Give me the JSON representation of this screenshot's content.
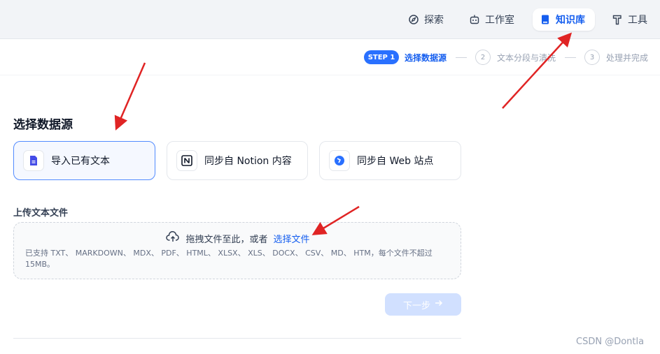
{
  "nav": {
    "items": [
      {
        "label": "探索",
        "icon": "compass-icon",
        "active": false
      },
      {
        "label": "工作室",
        "icon": "robot-icon",
        "active": false
      },
      {
        "label": "知识库",
        "icon": "book-icon",
        "active": true
      },
      {
        "label": "工具",
        "icon": "hammer-icon",
        "active": false
      }
    ]
  },
  "steps": {
    "badge": "STEP 1",
    "step1_label": "选择数据源",
    "step2_num": "2",
    "step2_label": "文本分段与清洗",
    "step3_num": "3",
    "step3_label": "处理并完成"
  },
  "main": {
    "title": "选择数据源",
    "sources": [
      {
        "label": "导入已有文本",
        "icon": "file-text-icon",
        "selected": true
      },
      {
        "label": "同步自 Notion 内容",
        "icon": "notion-icon",
        "selected": false
      },
      {
        "label": "同步自 Web 站点",
        "icon": "web-sync-icon",
        "selected": false
      }
    ],
    "upload_title": "上传文本文件",
    "dropzone": {
      "text": "拖拽文件至此，或者",
      "link": "选择文件",
      "hint": "已支持 TXT、 MARKDOWN、 MDX、 PDF、 HTML、 XLSX、 XLS、 DOCX、 CSV、 MD、 HTM，每个文件不超过 15MB。"
    },
    "next_button": "下一步"
  },
  "watermark": "CSDN @Dontla",
  "colors": {
    "accent": "#155eef",
    "step_badge": "#2970ff",
    "annotation_arrow": "#e02424"
  }
}
